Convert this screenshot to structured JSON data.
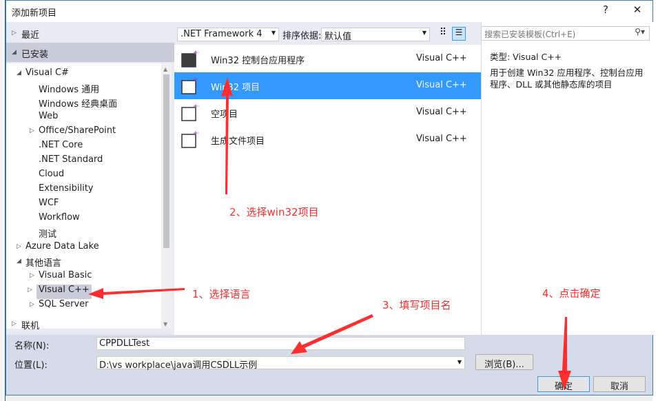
{
  "dialog": {
    "title": "添加新项目",
    "help": "?",
    "close": "✕"
  },
  "left": {
    "recent": "最近",
    "installed": "已安装",
    "online": "联机",
    "tree": [
      {
        "label": "Visual C#",
        "level": 0,
        "arrow": "◢"
      },
      {
        "label": "Windows 通用",
        "level": 1
      },
      {
        "label": "Windows 经典桌面",
        "level": 1
      },
      {
        "label": "Web",
        "level": 1
      },
      {
        "label": "Office/SharePoint",
        "level": 1,
        "arrow": "▷"
      },
      {
        "label": ".NET Core",
        "level": 1
      },
      {
        "label": ".NET Standard",
        "level": 1
      },
      {
        "label": "Cloud",
        "level": 1
      },
      {
        "label": "Extensibility",
        "level": 1
      },
      {
        "label": "WCF",
        "level": 1
      },
      {
        "label": "Workflow",
        "level": 1
      },
      {
        "label": "测试",
        "level": 1
      },
      {
        "label": "Azure Data Lake",
        "level": 0,
        "arrow": "▷"
      },
      {
        "label": "其他语言",
        "level": 0,
        "arrow": "◢"
      },
      {
        "label": "Visual Basic",
        "level": 1,
        "arrow": "▷"
      },
      {
        "label": "Visual C++",
        "level": 1,
        "arrow": "▷",
        "selected": true
      },
      {
        "label": "SQL Server",
        "level": 1,
        "arrow": "▷"
      }
    ]
  },
  "toolbar": {
    "framework": ".NET Framework 4",
    "sort_label": "排序依据:",
    "sort_value": "默认值"
  },
  "search": {
    "placeholder": "搜索已安装模板(Ctrl+E)"
  },
  "templates": [
    {
      "name": "Win32 控制台应用程序",
      "lang": "Visual C++"
    },
    {
      "name": "Win32 项目",
      "lang": "Visual C++",
      "selected": true
    },
    {
      "name": "空项目",
      "lang": "Visual C++"
    },
    {
      "name": "生成文件项目",
      "lang": "Visual C++"
    }
  ],
  "details": {
    "type": "类型:  Visual C++",
    "desc": "用于创建 Win32 应用程序、控制台应用程序、DLL 或其他静态库的项目"
  },
  "form": {
    "name_label": "名称(N):",
    "name_value": "CPPDLLTest",
    "location_label": "位置(L):",
    "location_value": "D:\\vs workplace\\java调用CSDLL示例",
    "browse": "浏览(B)...",
    "ok": "确定",
    "cancel": "取消"
  },
  "annotations": {
    "a1": "1、选择语言",
    "a2": "2、选择win32项目",
    "a3": "3、填写项目名",
    "a4": "4、点击确定"
  },
  "colors": {
    "selection": "#3399ff",
    "annotation": "#ff2d2d"
  }
}
